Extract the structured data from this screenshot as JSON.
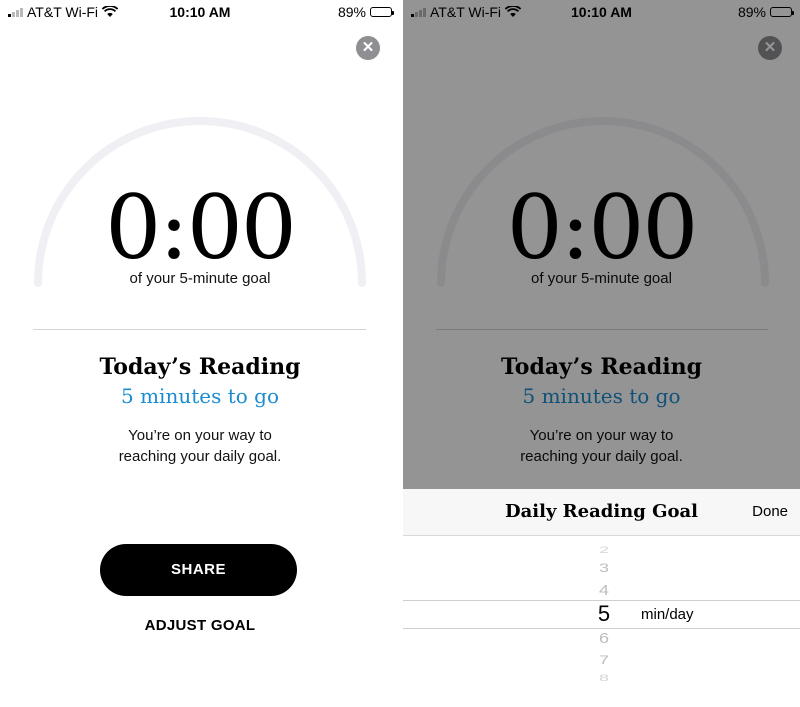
{
  "status_bar": {
    "carrier": "AT&T Wi-Fi",
    "time": "10:10 AM",
    "battery": "89%",
    "battery_level": 0.89
  },
  "reading_goal": {
    "timer": "0:00",
    "goal_subtitle": "of your 5-minute goal",
    "progress": 0,
    "today_title": "Today’s Reading",
    "to_go": "5 minutes to go",
    "message_line1": "You’re on your way to",
    "message_line2": "reaching your daily goal.",
    "share_label": "SHARE",
    "adjust_label": "ADJUST GOAL"
  },
  "picker_sheet": {
    "title": "Daily Reading Goal",
    "done_label": "Done",
    "options": [
      "2",
      "3",
      "4",
      "5",
      "6",
      "7",
      "8"
    ],
    "selected": "5",
    "unit": "min/day"
  },
  "colors": {
    "accent": "#1a8ccf",
    "ring": "#efeff4",
    "button": "#000000"
  }
}
